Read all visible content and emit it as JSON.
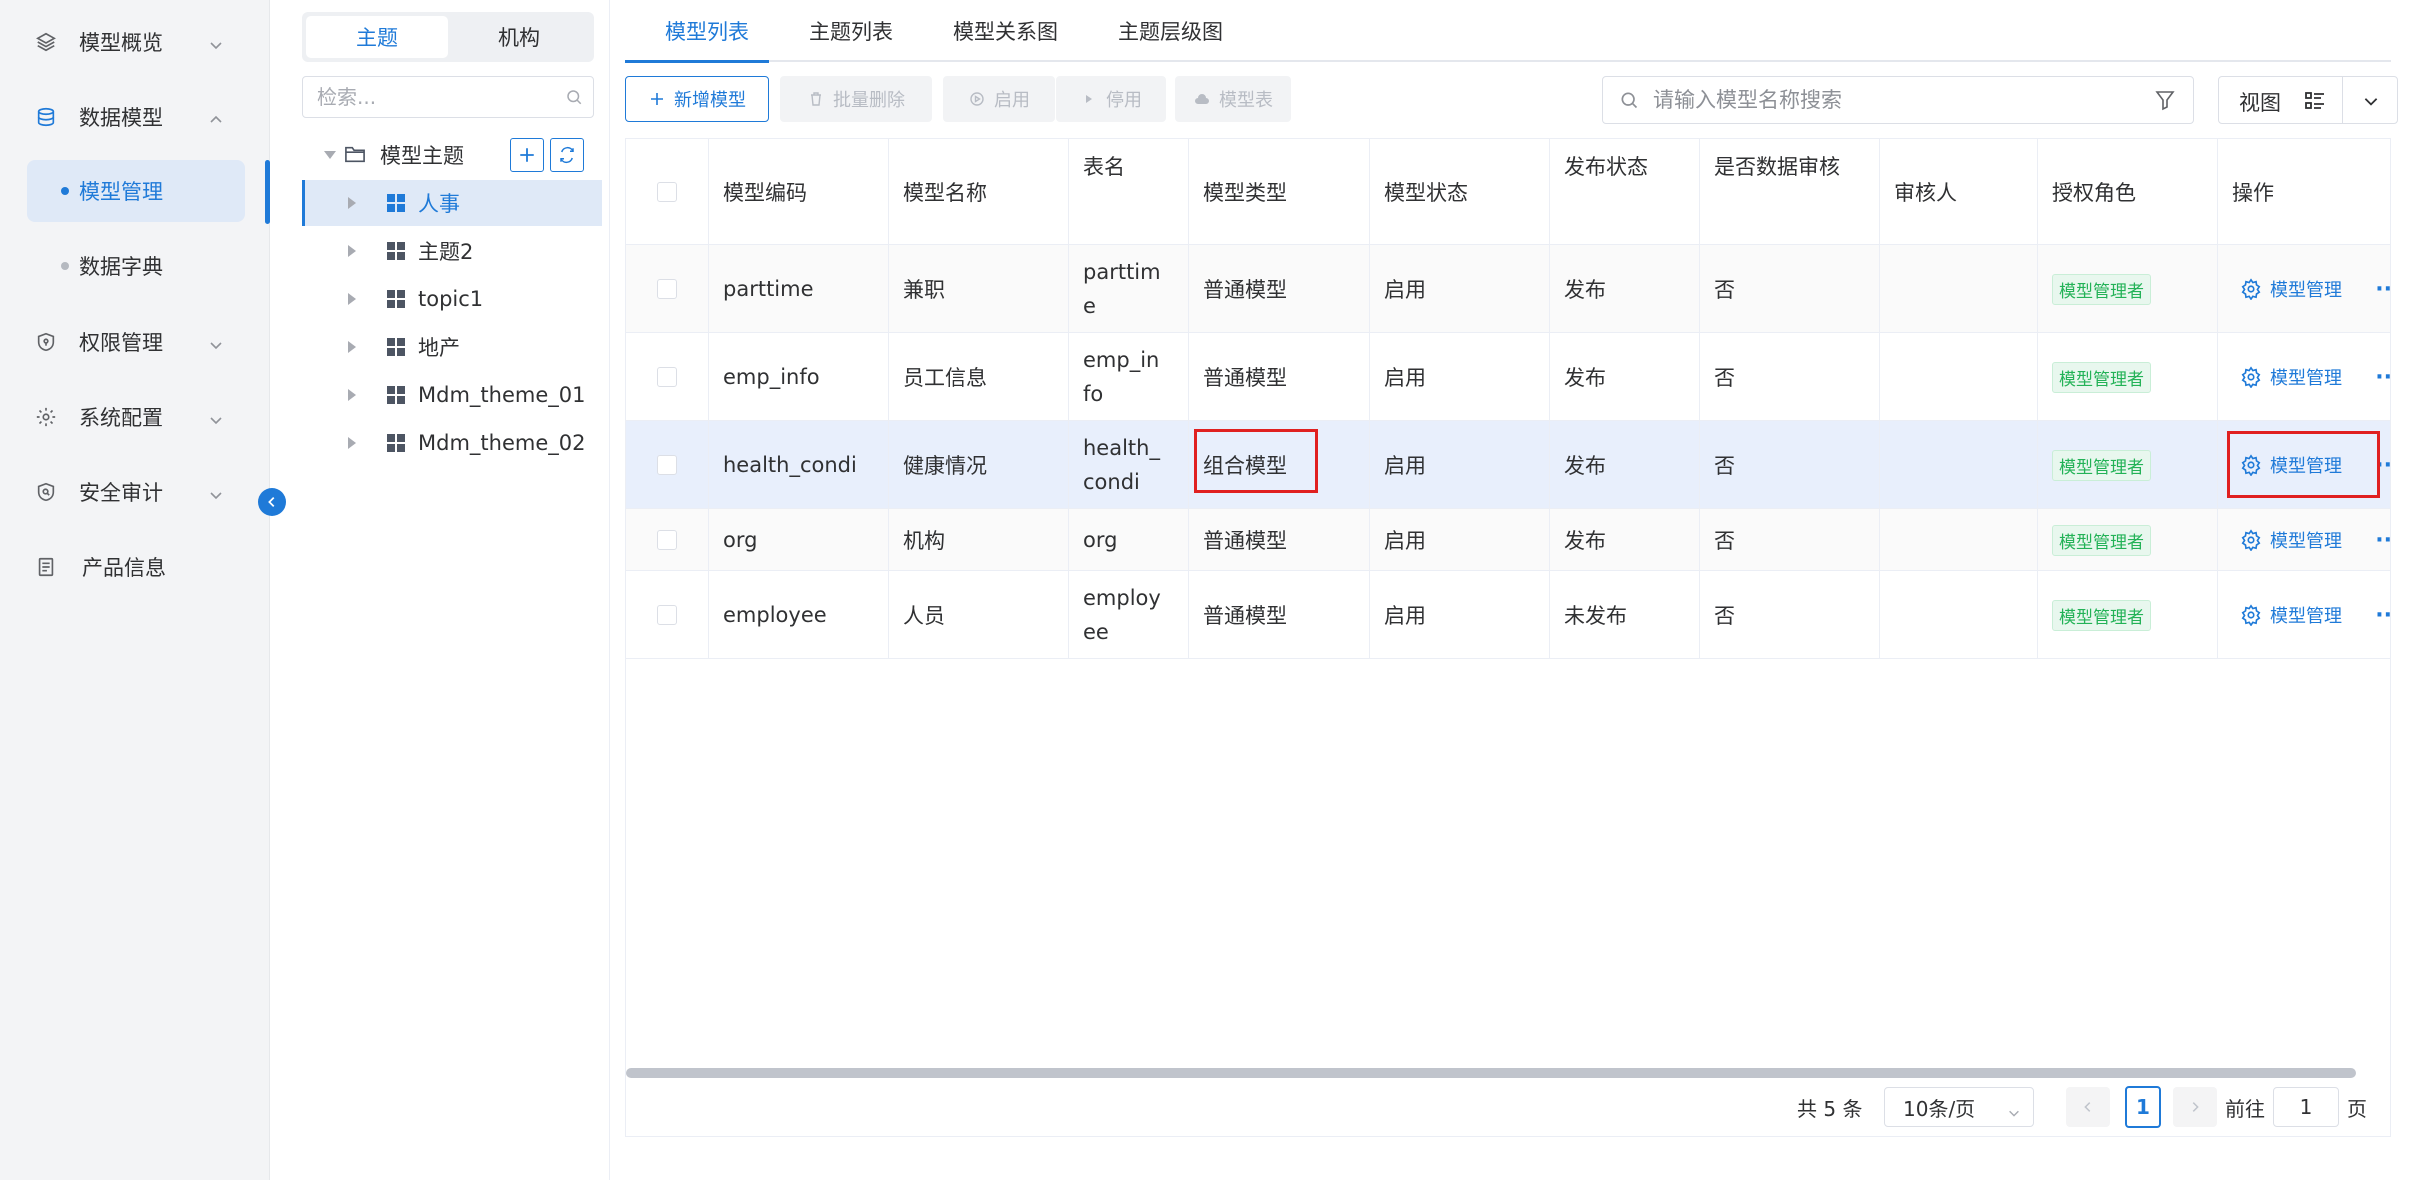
{
  "sidebar": {
    "items": [
      {
        "label": "模型概览",
        "icon": "layers-icon"
      },
      {
        "label": "数据模型",
        "icon": "database-icon"
      },
      {
        "label": "权限管理",
        "icon": "shield-icon"
      },
      {
        "label": "系统配置",
        "icon": "gear-icon"
      },
      {
        "label": "安全审计",
        "icon": "shield-search-icon"
      },
      {
        "label": "产品信息",
        "icon": "document-icon"
      }
    ],
    "sub_items": [
      {
        "label": "模型管理"
      },
      {
        "label": "数据字典"
      }
    ],
    "accent_color": "#1f7ad8"
  },
  "tree": {
    "segments": [
      "主题",
      "机构"
    ],
    "search_placeholder": "检索...",
    "root_label": "模型主题",
    "nodes": [
      "人事",
      "主题2",
      "topic1",
      "地产",
      "Mdm_theme_01",
      "Mdm_theme_02"
    ]
  },
  "tabs": [
    "模型列表",
    "主题列表",
    "模型关系图",
    "主题层级图"
  ],
  "toolbar": {
    "add": "新增模型",
    "batch_delete": "批量删除",
    "enable": "启用",
    "disable": "停用",
    "model_table": "模型表",
    "search_placeholder": "请输入模型名称搜索",
    "view_label": "视图"
  },
  "table": {
    "headers": [
      "模型编码",
      "模型名称",
      "表名",
      "模型类型",
      "模型状态",
      "发布状态",
      "是否数据审核",
      "审核人",
      "授权角色",
      "操作"
    ],
    "rows": [
      {
        "code": "parttime",
        "name": "兼职",
        "table_l1": "parttim",
        "table_l2": "e",
        "type": "普通模型",
        "status": "启用",
        "publish": "发布",
        "audit": "否",
        "auditor": "",
        "role": "模型管理者",
        "op": "模型管理"
      },
      {
        "code": "emp_info",
        "name": "员工信息",
        "table_l1": "emp_in",
        "table_l2": "fo",
        "type": "普通模型",
        "status": "启用",
        "publish": "发布",
        "audit": "否",
        "auditor": "",
        "role": "模型管理者",
        "op": "模型管理"
      },
      {
        "code": "health_condi",
        "name": "健康情况",
        "table_l1": "health_",
        "table_l2": "condi",
        "type": "组合模型",
        "status": "启用",
        "publish": "发布",
        "audit": "否",
        "auditor": "",
        "role": "模型管理者",
        "op": "模型管理"
      },
      {
        "code": "org",
        "name": "机构",
        "table_l1": "org",
        "table_l2": "",
        "type": "普通模型",
        "status": "启用",
        "publish": "发布",
        "audit": "否",
        "auditor": "",
        "role": "模型管理者",
        "op": "模型管理"
      },
      {
        "code": "employee",
        "name": "人员",
        "table_l1": "employ",
        "table_l2": "ee",
        "type": "普通模型",
        "status": "启用",
        "publish": "未发布",
        "audit": "否",
        "auditor": "",
        "role": "模型管理者",
        "op": "模型管理"
      }
    ]
  },
  "pagination": {
    "total": "共 5 条",
    "page_size": "10条/页",
    "current": "1",
    "goto_label": "前往",
    "goto_value": "1",
    "goto_suffix": "页"
  }
}
